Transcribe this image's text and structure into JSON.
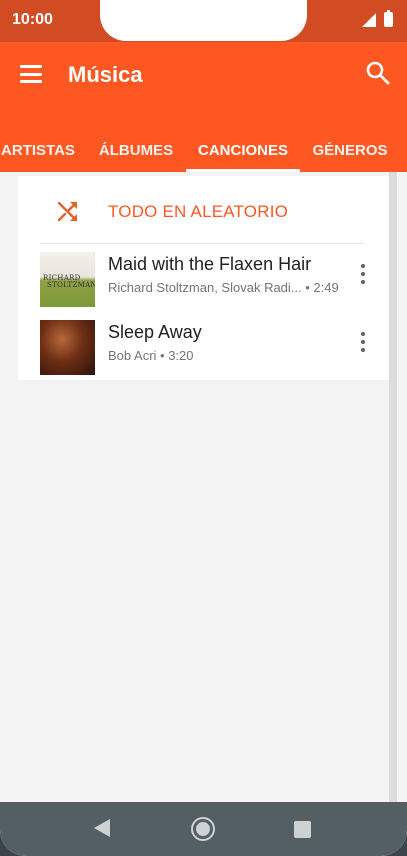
{
  "status": {
    "time": "10:00"
  },
  "toolbar": {
    "title": "Música",
    "menu_icon": "hamburger-menu-icon",
    "search_icon": "search-icon"
  },
  "tabs": [
    {
      "label": "ARTISTAS",
      "active": false
    },
    {
      "label": "ÁLBUMES",
      "active": false
    },
    {
      "label": "CANCIONES",
      "active": true
    },
    {
      "label": "GÉNEROS",
      "active": false
    }
  ],
  "shuffle": {
    "label": "TODO EN ALEATORIO",
    "icon": "shuffle-icon"
  },
  "songs": [
    {
      "title": "Maid with the Flaxen Hair",
      "subtitle": "Richard Stoltzman, Slovak Radi... • 2:49",
      "art_text_line1": "RICHARD",
      "art_text_line2": "STOLTZMAN"
    },
    {
      "title": "Sleep Away",
      "subtitle": "Bob Acri • 3:20"
    }
  ],
  "colors": {
    "accent": "#ff5722",
    "statusbar": "#d14c22",
    "navbar": "#545f63"
  }
}
